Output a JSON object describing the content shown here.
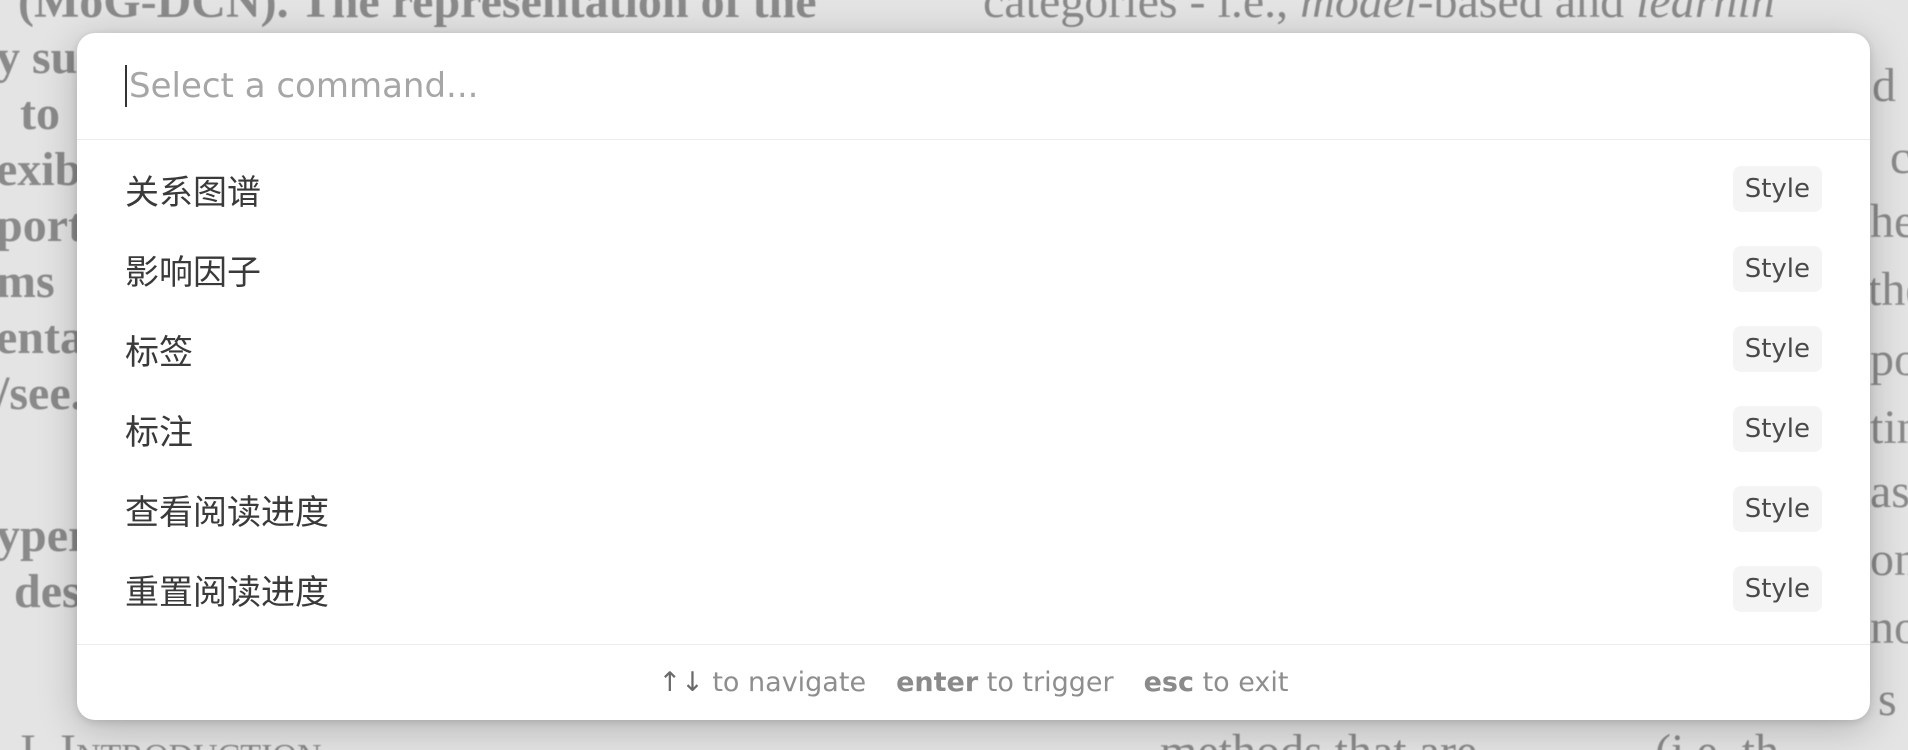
{
  "background_document": {
    "lines": [
      "(MoG-DCN). The representation of the",
      "y su",
      "to",
      "exib",
      "porte",
      "ms",
      "enta",
      "/see.",
      "yper",
      "des",
      "categories - i.e.,",
      "model",
      "-based and",
      "learnin",
      "d",
      "c",
      "he",
      "the",
      "po",
      "tin",
      "ase",
      "on",
      "no",
      "s",
      "I. Introduction",
      "methods that are",
      "(i.e. th"
    ]
  },
  "palette": {
    "search": {
      "placeholder": "Select a command...",
      "value": ""
    },
    "items": [
      {
        "label": "关系图谱",
        "badge": "Style"
      },
      {
        "label": "影响因子",
        "badge": "Style"
      },
      {
        "label": "标签",
        "badge": "Style"
      },
      {
        "label": "标注",
        "badge": "Style"
      },
      {
        "label": "查看阅读进度",
        "badge": "Style"
      },
      {
        "label": "重置阅读进度",
        "badge": "Style"
      }
    ],
    "footer": {
      "navigate_keys": "↑↓",
      "navigate_text": "to navigate",
      "trigger_key": "enter",
      "trigger_text": "to trigger",
      "exit_key": "esc",
      "exit_text": "to exit"
    }
  }
}
